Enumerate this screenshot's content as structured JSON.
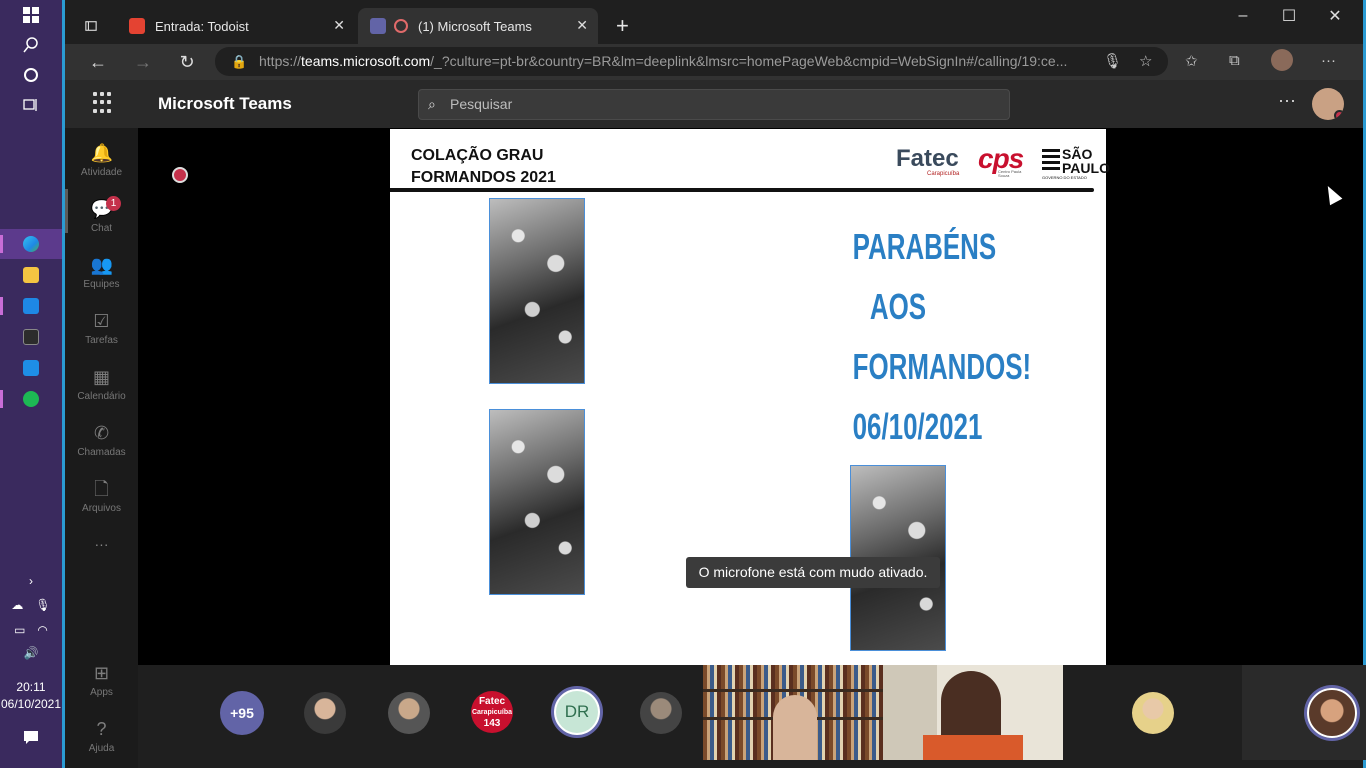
{
  "taskbar": {
    "time": "20:11",
    "date": "06/10/2021"
  },
  "browser": {
    "tabs": [
      {
        "title": "Entrada: Todoist",
        "active": false
      },
      {
        "title": "(1) Microsoft Teams",
        "active": true
      }
    ],
    "url_host": "teams.microsoft.com",
    "url_rest": "/_?culture=pt-br&country=BR&lm=deeplink&lmsrc=homePageWeb&cmpid=WebSignIn#/calling/19:ce...",
    "url_prefix": "https://"
  },
  "teams": {
    "app_title": "Microsoft Teams",
    "search_placeholder": "Pesquisar",
    "rail": [
      {
        "label": "Atividade",
        "icon": "bell-icon"
      },
      {
        "label": "Chat",
        "icon": "chat-icon",
        "badge": "1"
      },
      {
        "label": "Equipes",
        "icon": "teams-icon"
      },
      {
        "label": "Tarefas",
        "icon": "tasks-icon"
      },
      {
        "label": "Calendário",
        "icon": "calendar-icon"
      },
      {
        "label": "Chamadas",
        "icon": "phone-icon"
      },
      {
        "label": "Arquivos",
        "icon": "file-icon"
      }
    ],
    "rail_more": "···",
    "rail_bottom": [
      {
        "label": "Apps",
        "icon": "apps-icon"
      },
      {
        "label": "Ajuda",
        "icon": "help-icon"
      }
    ]
  },
  "slide": {
    "title_line1": "COLAÇÃO GRAU",
    "title_line2": "FORMANDOS 2021",
    "logo_fatec": "Fatec",
    "logo_fatec_sub": "Carapicuíba",
    "logo_cps": "cps",
    "logo_cps_sub": "Centro Paula Souza",
    "logo_sp": "SÃO PAULO",
    "logo_sp_sub": "GOVERNO DO ESTADO",
    "congrats": [
      "PARABÉNS",
      "AOS",
      "FORMANDOS!",
      "06/10/2021"
    ]
  },
  "toast": "O microfone está com mudo ativado.",
  "participants": {
    "overflow_count": "+95",
    "initials": "DR",
    "fatec_avatar_line1": "Fatec",
    "fatec_avatar_line2": "Carapicuíba",
    "fatec_avatar_count": "143"
  },
  "colors": {
    "teams_purple": "#6264a7",
    "slide_blue": "#2a7fc4",
    "alert_red": "#c4314b"
  }
}
